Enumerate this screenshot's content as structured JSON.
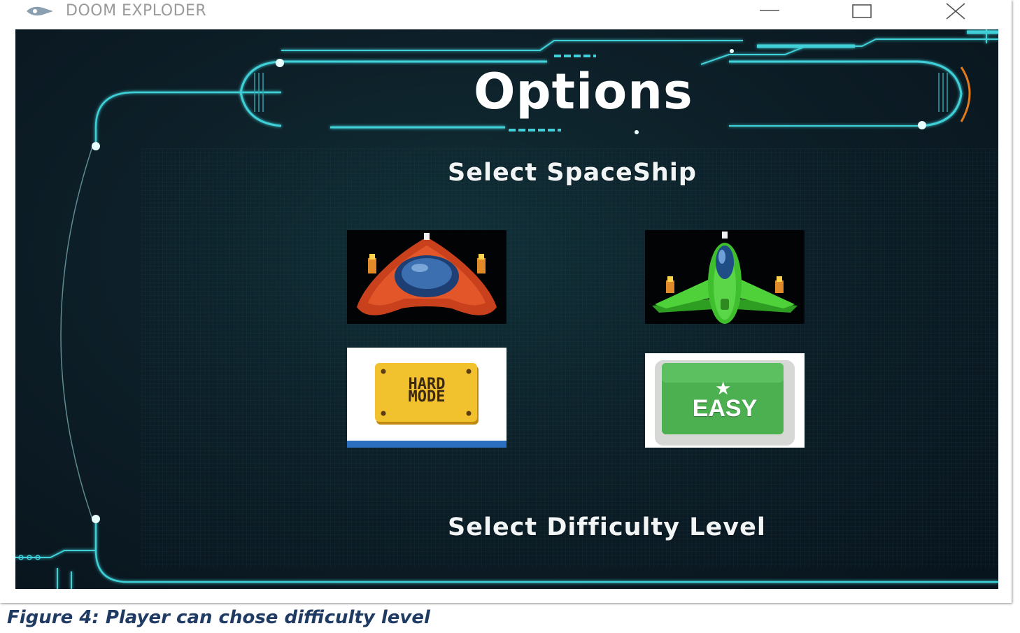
{
  "window": {
    "title": "DOOM EXPLODER",
    "icon": "app-icon",
    "controls": {
      "minimize": "minimize-icon",
      "maximize": "maximize-icon",
      "close": "close-icon"
    }
  },
  "game": {
    "heading": "Options",
    "spaceship_label": "Select SpaceShip",
    "difficulty_label": "Select Difficulty Level",
    "ships": [
      {
        "name": "red-spaceship",
        "color": "#c8401c"
      },
      {
        "name": "green-spaceship",
        "color": "#3fbf2e"
      }
    ],
    "difficulty": {
      "hard_line1": "HARD",
      "hard_line2": "MODE",
      "easy": "EASY"
    },
    "colors": {
      "frame_cyan": "#3fd0d8",
      "accent_orange": "#e07a1a",
      "hard_yellow": "#f2c12e",
      "easy_green": "#4caf50"
    }
  },
  "caption": "Figure 4: Player can chose difficulty level"
}
